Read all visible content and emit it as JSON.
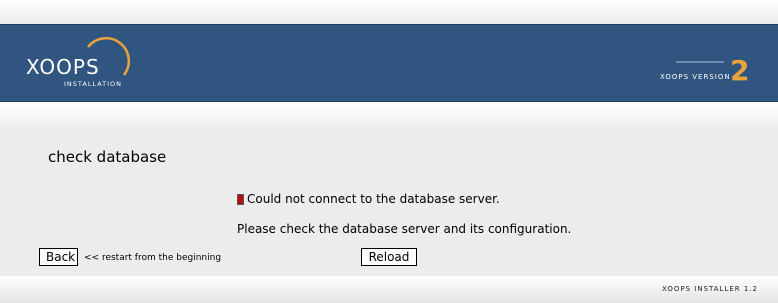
{
  "header": {
    "logo_text": "XOOPS",
    "logo_subtext": "INSTALLATION",
    "version_label": "XOOPS VERSION",
    "version_number": "2"
  },
  "main": {
    "title": "check database",
    "error_message": "Could not connect to the database server.",
    "hint_message": "Please check the database server and its configuration.",
    "back_label": "Back",
    "restart_text": "<< restart from the beginning",
    "reload_label": "Reload"
  },
  "footer": {
    "installer_version": "XOOPS INSTALLER 1.2"
  },
  "colors": {
    "header_bg": "#2f5580",
    "accent_orange": "#e8a33c",
    "content_bg": "#ececec",
    "error_red": "#b01010"
  }
}
